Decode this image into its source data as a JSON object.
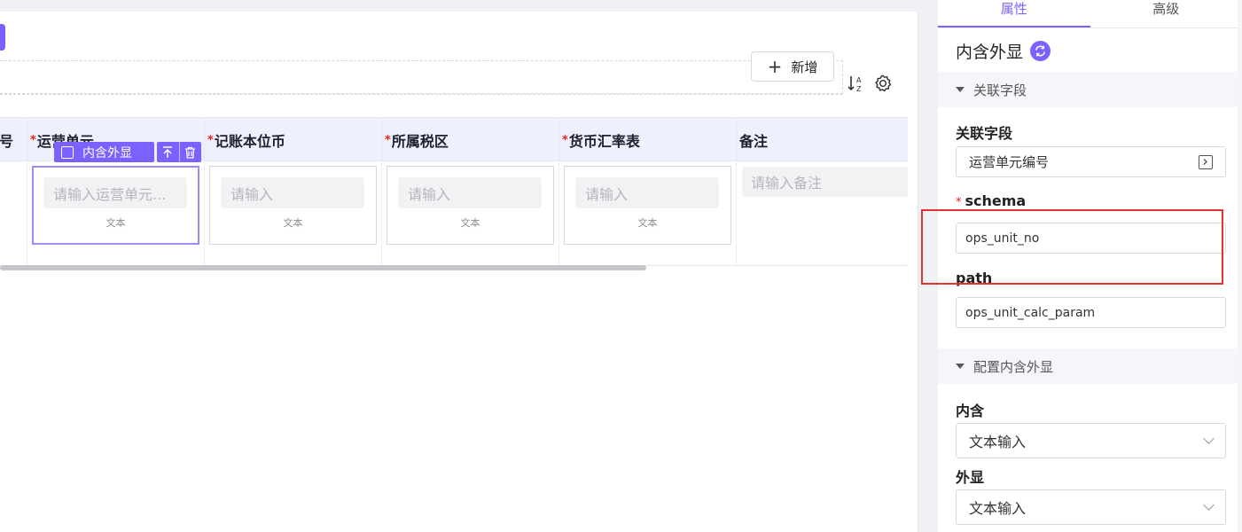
{
  "canvas": {
    "add_button_label": "新增",
    "table": {
      "columns": [
        {
          "label": "号",
          "required": false
        },
        {
          "label": "运营单元",
          "required": true
        },
        {
          "label": "记账本位币",
          "required": true
        },
        {
          "label": "所属税区",
          "required": true
        },
        {
          "label": "货币汇率表",
          "required": true
        },
        {
          "label": "备注",
          "required": false
        }
      ],
      "cells": [
        {
          "placeholder": "请输入运营单元...",
          "hint": "文本"
        },
        {
          "placeholder": "请输入",
          "hint": "文本"
        },
        {
          "placeholder": "请输入",
          "hint": "文本"
        },
        {
          "placeholder": "请输入",
          "hint": "文本"
        }
      ],
      "note_placeholder": "请输入备注"
    },
    "selection": {
      "label": "内含外显",
      "up_icon": "arrow-up-icon",
      "delete_icon": "trash-icon"
    }
  },
  "panel": {
    "tabs": [
      "属性",
      "高级"
    ],
    "active_tab": "属性",
    "component_title": "内含外显",
    "section_link": "关联字段",
    "link_field_label": "关联字段",
    "link_field_value": "运营单元编号",
    "schema_label": "schema",
    "schema_value": "ops_unit_no",
    "path_label": "path",
    "path_value": "ops_unit_calc_param",
    "section_config": "配置内含外显",
    "inner_label": "内含",
    "inner_value": "文本输入",
    "outer_label": "外显",
    "outer_value": "文本输入"
  },
  "colors": {
    "accent": "#7b61ff",
    "required": "#e02020",
    "highlight": "#e5322d",
    "header_bg": "#eef0fb"
  }
}
